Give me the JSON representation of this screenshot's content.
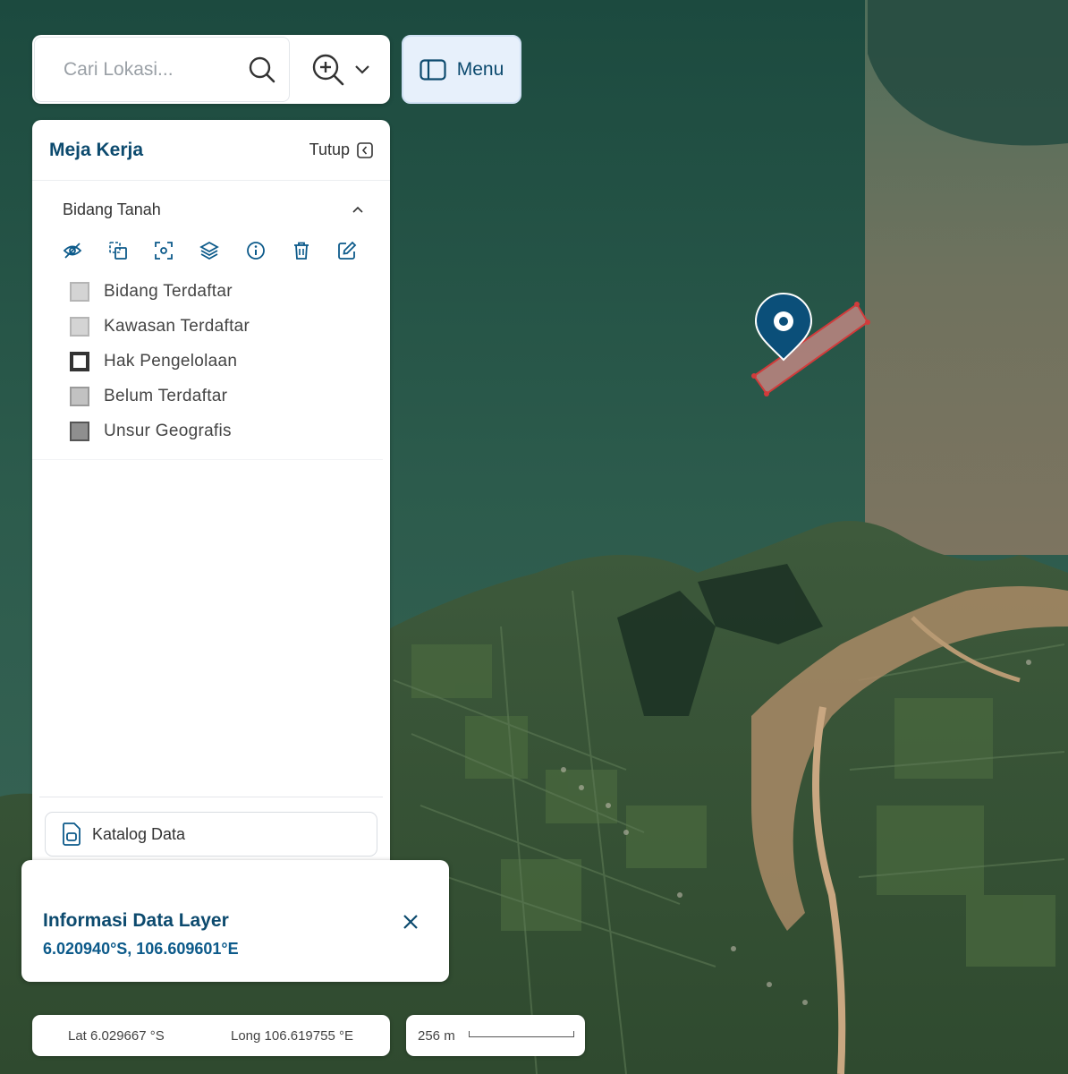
{
  "search": {
    "placeholder": "Cari Lokasi..."
  },
  "menu": {
    "label": "Menu"
  },
  "panel": {
    "title": "Meja Kerja",
    "close_label": "Tutup",
    "layer": {
      "name": "Bidang Tanah",
      "tools": [
        "eye-off-icon",
        "copy-icon",
        "focus-icon",
        "layers-icon",
        "info-icon",
        "trash-icon",
        "edit-icon"
      ],
      "legend": [
        {
          "label": "Bidang Terdaftar",
          "fill": "#d4d4d4",
          "border": "#b5b5b5"
        },
        {
          "label": "Kawasan Terdaftar",
          "fill": "#d4d4d4",
          "border": "#b5b5b5"
        },
        {
          "label": "Hak Pengelolaan",
          "fill": "#ffffff",
          "border": "#333333"
        },
        {
          "label": "Belum Terdaftar",
          "fill": "#c2c2c2",
          "border": "#9a9a9a"
        },
        {
          "label": "Unsur Geografis",
          "fill": "#8f8f8f",
          "border": "#555555"
        }
      ]
    },
    "katalog_label": "Katalog Data"
  },
  "info_popup": {
    "title": "Informasi Data Layer",
    "coords": "6.020940°S, 106.609601°E"
  },
  "coordinates": {
    "lat": "Lat 6.029667 °S",
    "long": "Long 106.619755 °E"
  },
  "scale": {
    "label": "256 m"
  },
  "colors": {
    "accent": "#0c4a6e",
    "marker": "#0b4f79",
    "parcel_fill": "#c98a86",
    "parcel_stroke": "#d23b3b"
  }
}
